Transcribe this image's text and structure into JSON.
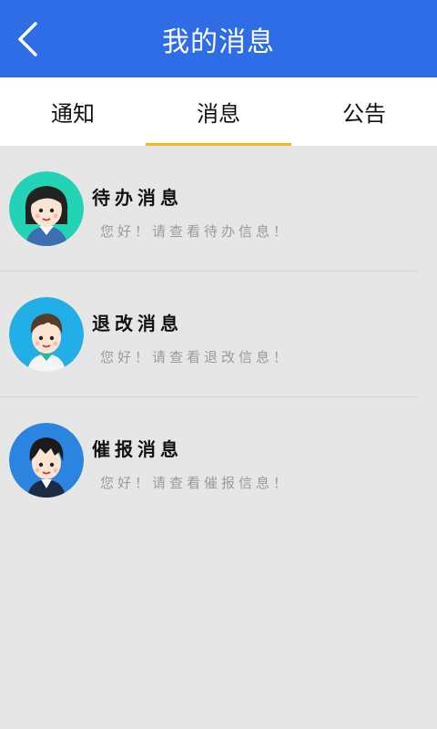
{
  "header": {
    "title": "我的消息",
    "back_icon": "chevron-left-icon"
  },
  "tabs": [
    {
      "label": "通知",
      "active": false
    },
    {
      "label": "消息",
      "active": true
    },
    {
      "label": "公告",
      "active": false
    }
  ],
  "colors": {
    "header": "#2e6de6",
    "tab_indicator": "#f5b820",
    "background": "#e6e6e6"
  },
  "messages": [
    {
      "title": "待办消息",
      "subtitle": "您好！请查看待办信息！",
      "avatar_bg": "#22d3b6",
      "avatar": "girl-avatar-icon"
    },
    {
      "title": "退改消息",
      "subtitle": "您好！请查看退改信息！",
      "avatar_bg": "#22aee6",
      "avatar": "boy-avatar-icon"
    },
    {
      "title": "催报消息",
      "subtitle": "您好！请查看催报信息！",
      "avatar_bg": "#2a84e0",
      "avatar": "boy-avatar-icon"
    }
  ]
}
